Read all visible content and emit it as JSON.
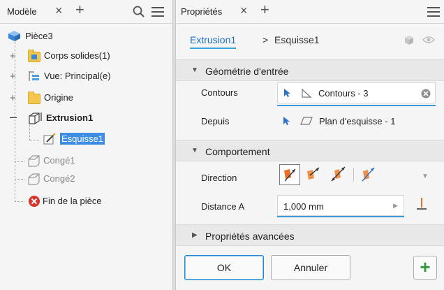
{
  "browser": {
    "tab_label": "Modèle",
    "tree": {
      "root": "Pièce3",
      "items": [
        {
          "label": "Corps solides(1)"
        },
        {
          "label": "Vue: Principal(e)"
        },
        {
          "label": "Origine"
        },
        {
          "label": "Extrusion1"
        },
        {
          "label": "Esquisse1"
        },
        {
          "label": "Congé1"
        },
        {
          "label": "Congé2"
        },
        {
          "label": "Fin de la pièce"
        }
      ]
    }
  },
  "properties": {
    "tab_label": "Propriétés",
    "breadcrumb": {
      "link": "Extrusion1",
      "separator": ">",
      "current": "Esquisse1"
    },
    "sections": {
      "input_geometry": {
        "title": "Géométrie d'entrée",
        "contours_label": "Contours",
        "contours_value": "Contours - 3",
        "from_label": "Depuis",
        "from_value": "Plan d'esquisse - 1"
      },
      "behavior": {
        "title": "Comportement",
        "direction_label": "Direction",
        "distance_label": "Distance A",
        "distance_value": "1,000 mm"
      },
      "advanced": {
        "title": "Propriétés avancées"
      }
    },
    "buttons": {
      "ok": "OK",
      "cancel": "Annuler",
      "add": "+"
    }
  },
  "colors": {
    "accent_blue": "#1f6fc5",
    "selection": "#3c8de3",
    "direction_orange": "#e8702a",
    "add_green": "#2f9d3a",
    "error_red": "#d9342b"
  }
}
